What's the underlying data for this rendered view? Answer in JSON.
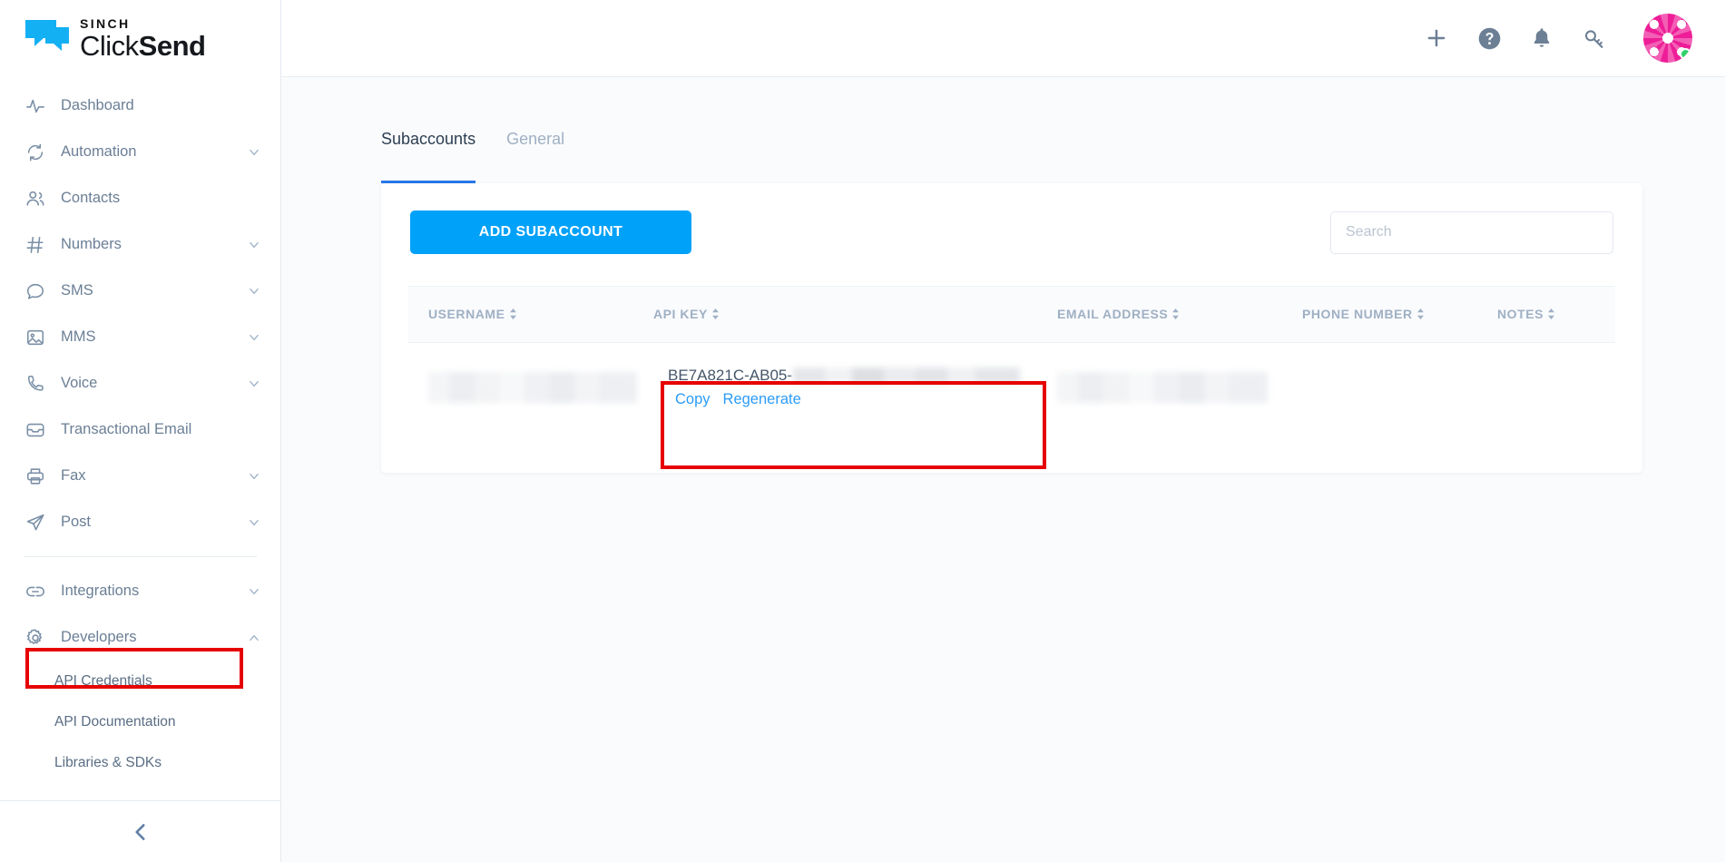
{
  "brand": {
    "sinch": "SINCH",
    "click": "Click",
    "send": "Send",
    "logo_icon": "speech-bubbles-icon"
  },
  "sidebar": {
    "items": [
      {
        "label": "Dashboard",
        "icon": "activity-pulse-icon",
        "chevron": "none"
      },
      {
        "label": "Automation",
        "icon": "refresh-cycle-icon",
        "chevron": "down"
      },
      {
        "label": "Contacts",
        "icon": "users-icon",
        "chevron": "none"
      },
      {
        "label": "Numbers",
        "icon": "hash-icon",
        "chevron": "down"
      },
      {
        "label": "SMS",
        "icon": "chat-bubble-icon",
        "chevron": "down"
      },
      {
        "label": "MMS",
        "icon": "image-icon",
        "chevron": "down"
      },
      {
        "label": "Voice",
        "icon": "phone-icon",
        "chevron": "down"
      },
      {
        "label": "Transactional Email",
        "icon": "inbox-icon",
        "chevron": "none"
      },
      {
        "label": "Fax",
        "icon": "printer-icon",
        "chevron": "down"
      },
      {
        "label": "Post",
        "icon": "paper-plane-icon",
        "chevron": "down"
      }
    ],
    "items2": [
      {
        "label": "Integrations",
        "icon": "link-icon",
        "chevron": "down"
      },
      {
        "label": "Developers",
        "icon": "gear-icon",
        "chevron": "up"
      }
    ],
    "subitems": [
      {
        "label": "API Credentials",
        "highlighted": true
      },
      {
        "label": "API Documentation",
        "highlighted": false
      },
      {
        "label": "Libraries & SDKs",
        "highlighted": false
      }
    ],
    "collapse_icon": "chevron-left-icon"
  },
  "topbar": {
    "icons": [
      {
        "name": "plus-icon"
      },
      {
        "name": "help-circle-icon"
      },
      {
        "name": "bell-icon"
      },
      {
        "name": "key-icon"
      }
    ],
    "avatar": {
      "name": "user-avatar",
      "status": "online"
    }
  },
  "tabs": [
    {
      "label": "Subaccounts",
      "active": true
    },
    {
      "label": "General",
      "active": false
    }
  ],
  "toolbar": {
    "add_subaccount_label": "ADD SUBACCOUNT",
    "search_placeholder": "Search",
    "search_value": ""
  },
  "table": {
    "columns": [
      {
        "label": "USERNAME",
        "sortable": true
      },
      {
        "label": "API KEY",
        "sortable": true
      },
      {
        "label": "EMAIL ADDRESS",
        "sortable": true
      },
      {
        "label": "PHONE NUMBER",
        "sortable": true
      },
      {
        "label": "NOTES",
        "sortable": true
      }
    ],
    "rows": [
      {
        "username": "",
        "api_key_visible": "BE7A821C-AB05-",
        "api_key_redacted": true,
        "copy_label": "Copy",
        "regenerate_label": "Regenerate",
        "email": "",
        "phone": "",
        "notes": ""
      }
    ]
  },
  "highlights": [
    {
      "name": "api-credentials-highlight",
      "color": "#e60000"
    },
    {
      "name": "api-key-highlight",
      "color": "#e60000"
    }
  ],
  "colors": {
    "accent_blue": "#00a1f9",
    "link_blue": "#2b9cf8",
    "tab_underline": "#2878e8",
    "highlight_red": "#e60000",
    "sidebar_text": "#6b7f96",
    "avatar_pink": "#ed1e97",
    "status_green": "#2fd36a"
  }
}
